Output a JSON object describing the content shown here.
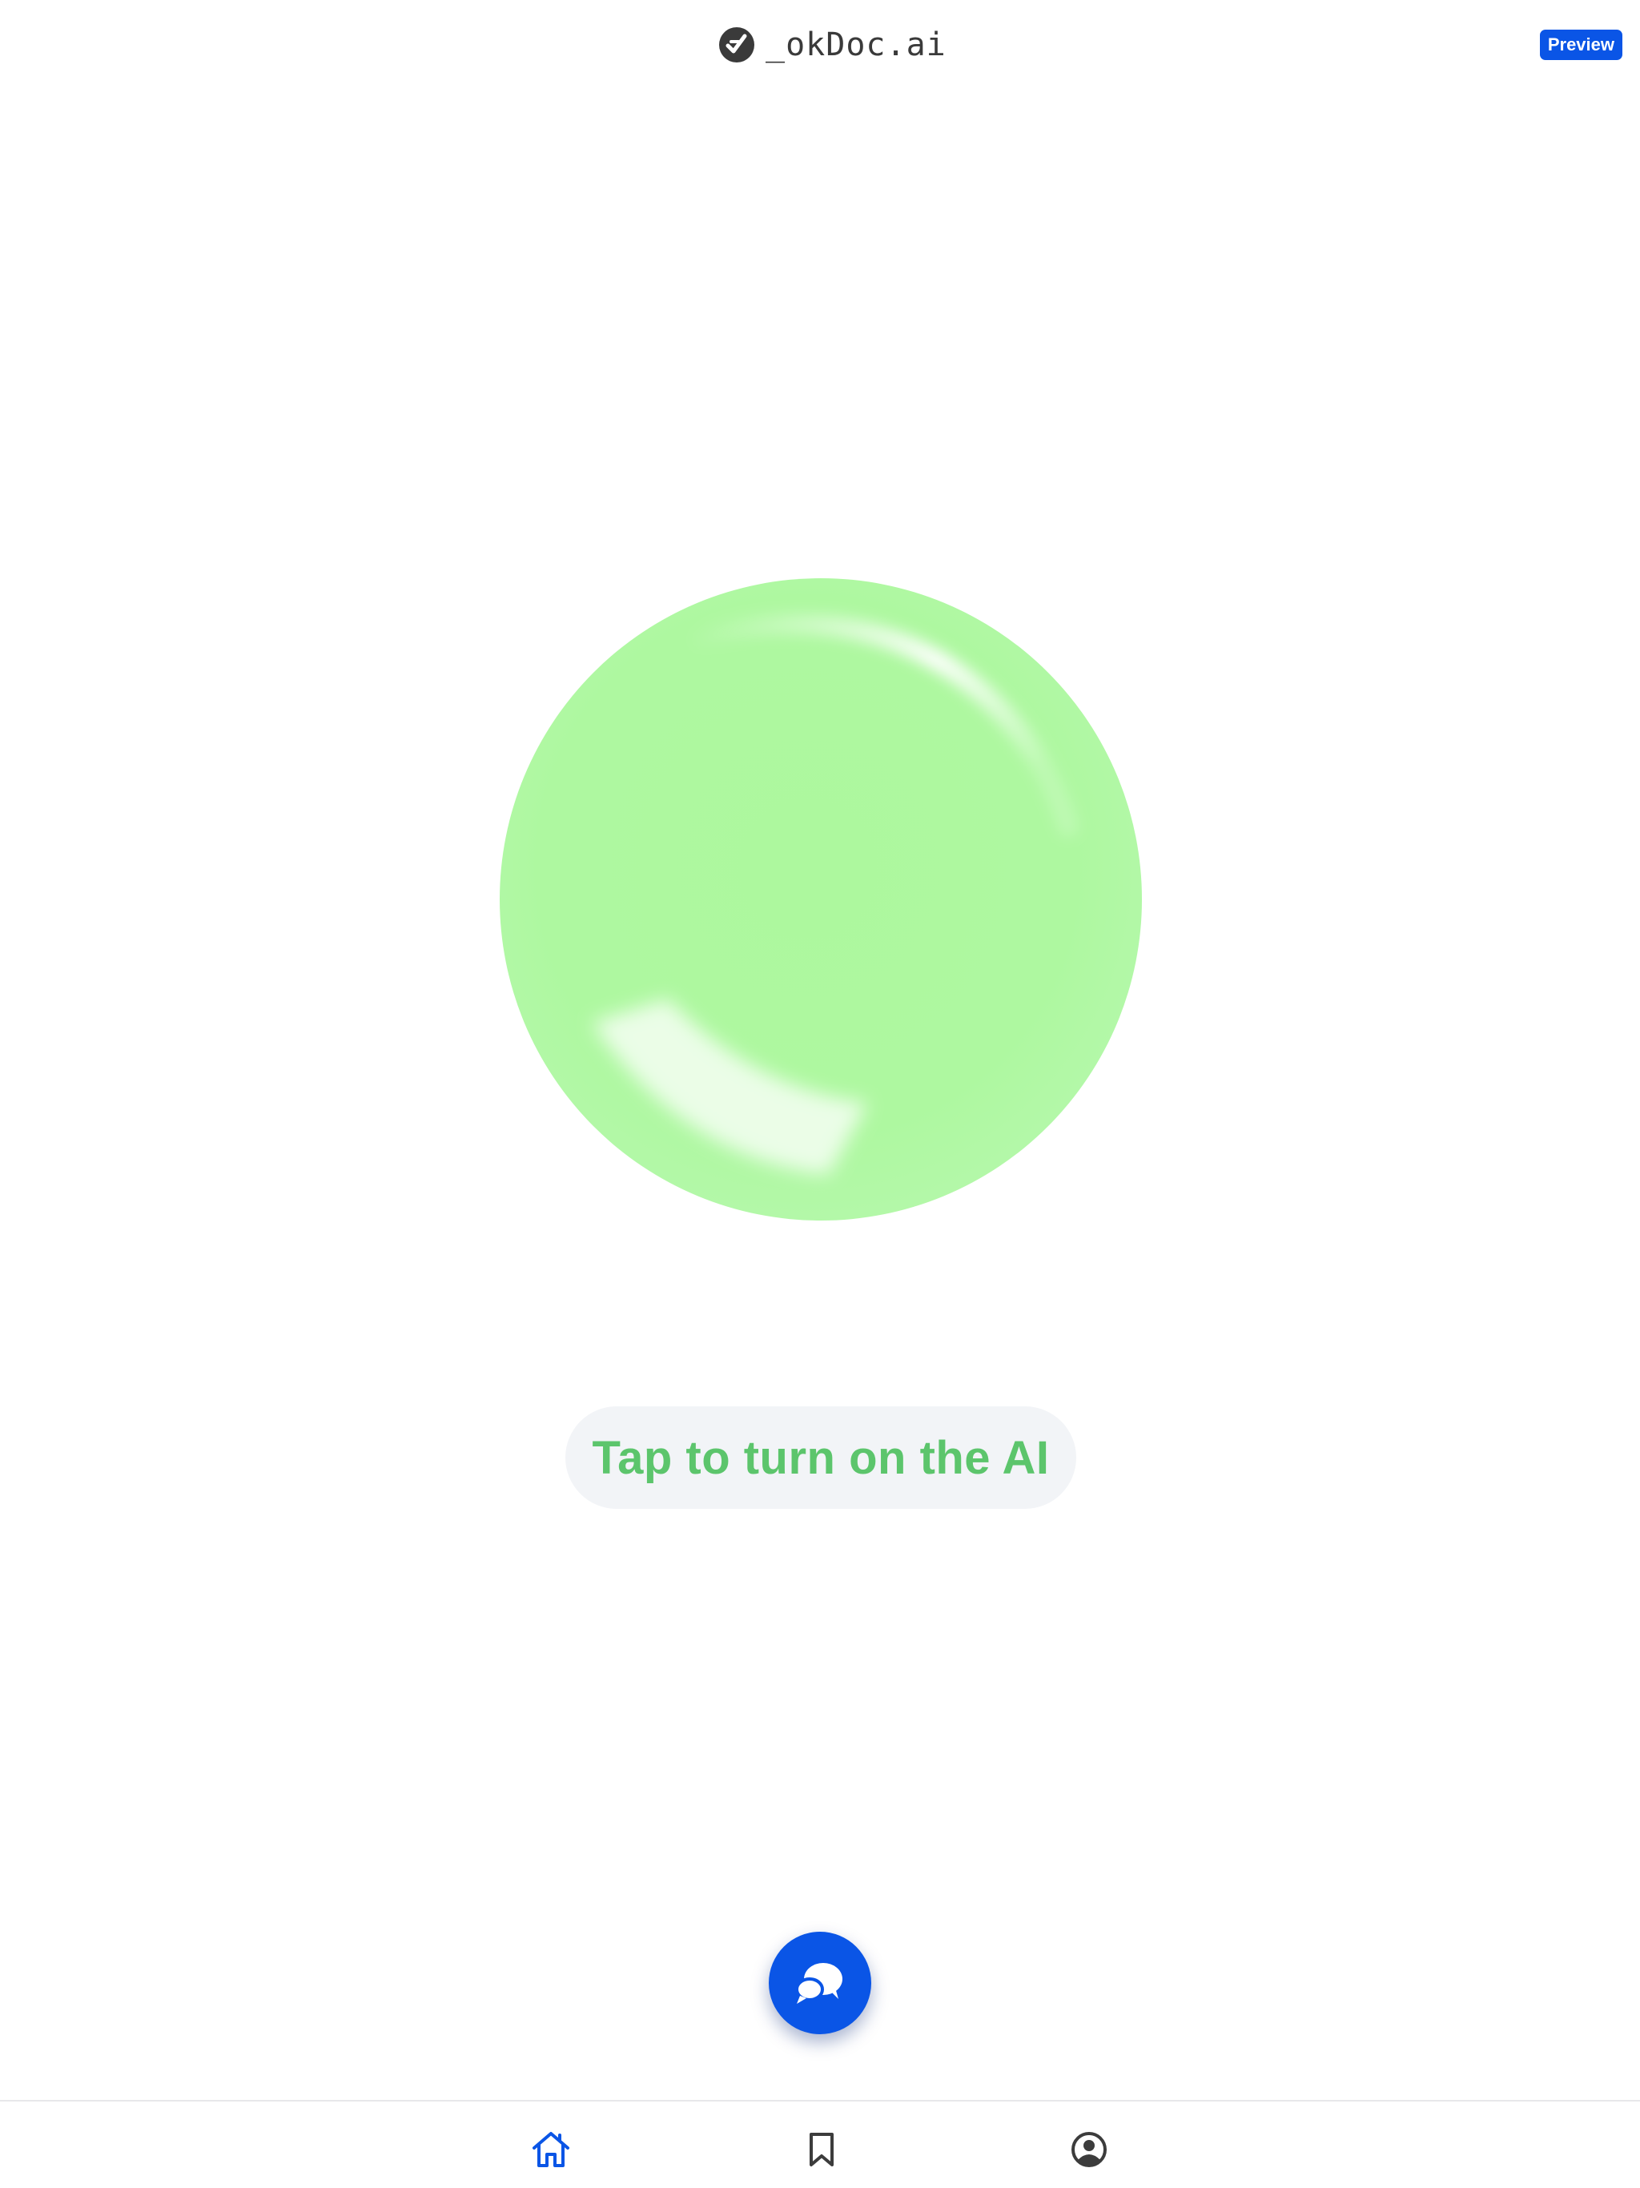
{
  "header": {
    "brand_name": "_okDoc.ai",
    "badge_label": "Preview"
  },
  "main": {
    "cta_label": "Tap to turn on the AI",
    "orb_color": "#aef8a0",
    "cta_color": "#5cc56c"
  },
  "fab": {
    "icon": "chat-bubbles-icon",
    "color": "#0a55e6"
  },
  "tabbar": {
    "items": [
      {
        "icon": "home-icon",
        "active": true
      },
      {
        "icon": "bookmark-icon",
        "active": false
      },
      {
        "icon": "profile-icon",
        "active": false
      }
    ],
    "active_color": "#0a55e6",
    "inactive_color": "#3c3c3c"
  }
}
